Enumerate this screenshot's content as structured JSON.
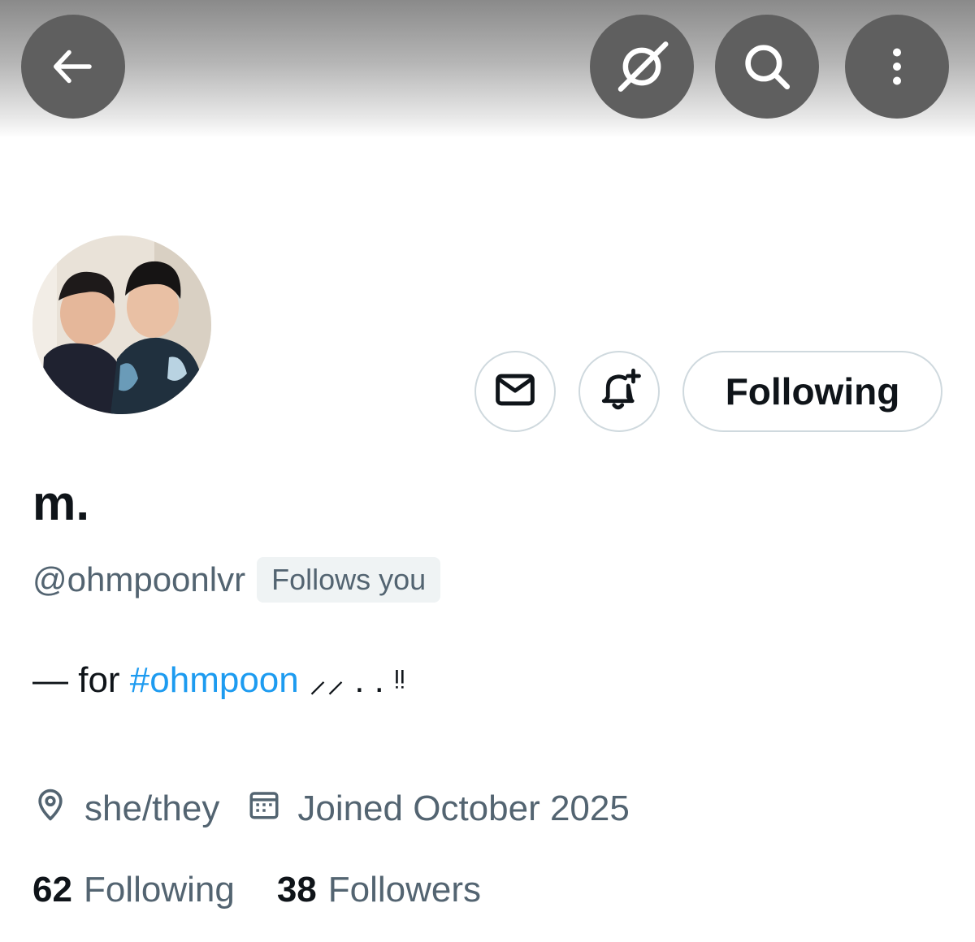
{
  "header": {
    "icons": {
      "back": "arrow-left-icon",
      "grok": "grok-icon",
      "search": "search-icon",
      "more": "more-vertical-icon"
    },
    "button_color": "#5f5f5f"
  },
  "profile": {
    "display_name": "m.",
    "handle": "@ohmpoonlvr",
    "follows_you_badge": "Follows you",
    "bio": {
      "prefix": "— for ",
      "hashtag": "#ohmpoon",
      "suffix": " ⸝⸝ . . ᵎᵎ"
    },
    "location": "she/they",
    "joined": "Joined October 2025"
  },
  "actions": {
    "message_icon": "envelope-icon",
    "notify_icon": "bell-plus-icon",
    "following_label": "Following"
  },
  "stats": {
    "following_count": "62",
    "following_label": "Following",
    "followers_count": "38",
    "followers_label": "Followers"
  },
  "colors": {
    "link": "#1d9bf0",
    "secondary_text": "#536471",
    "border": "#cfd9de"
  }
}
